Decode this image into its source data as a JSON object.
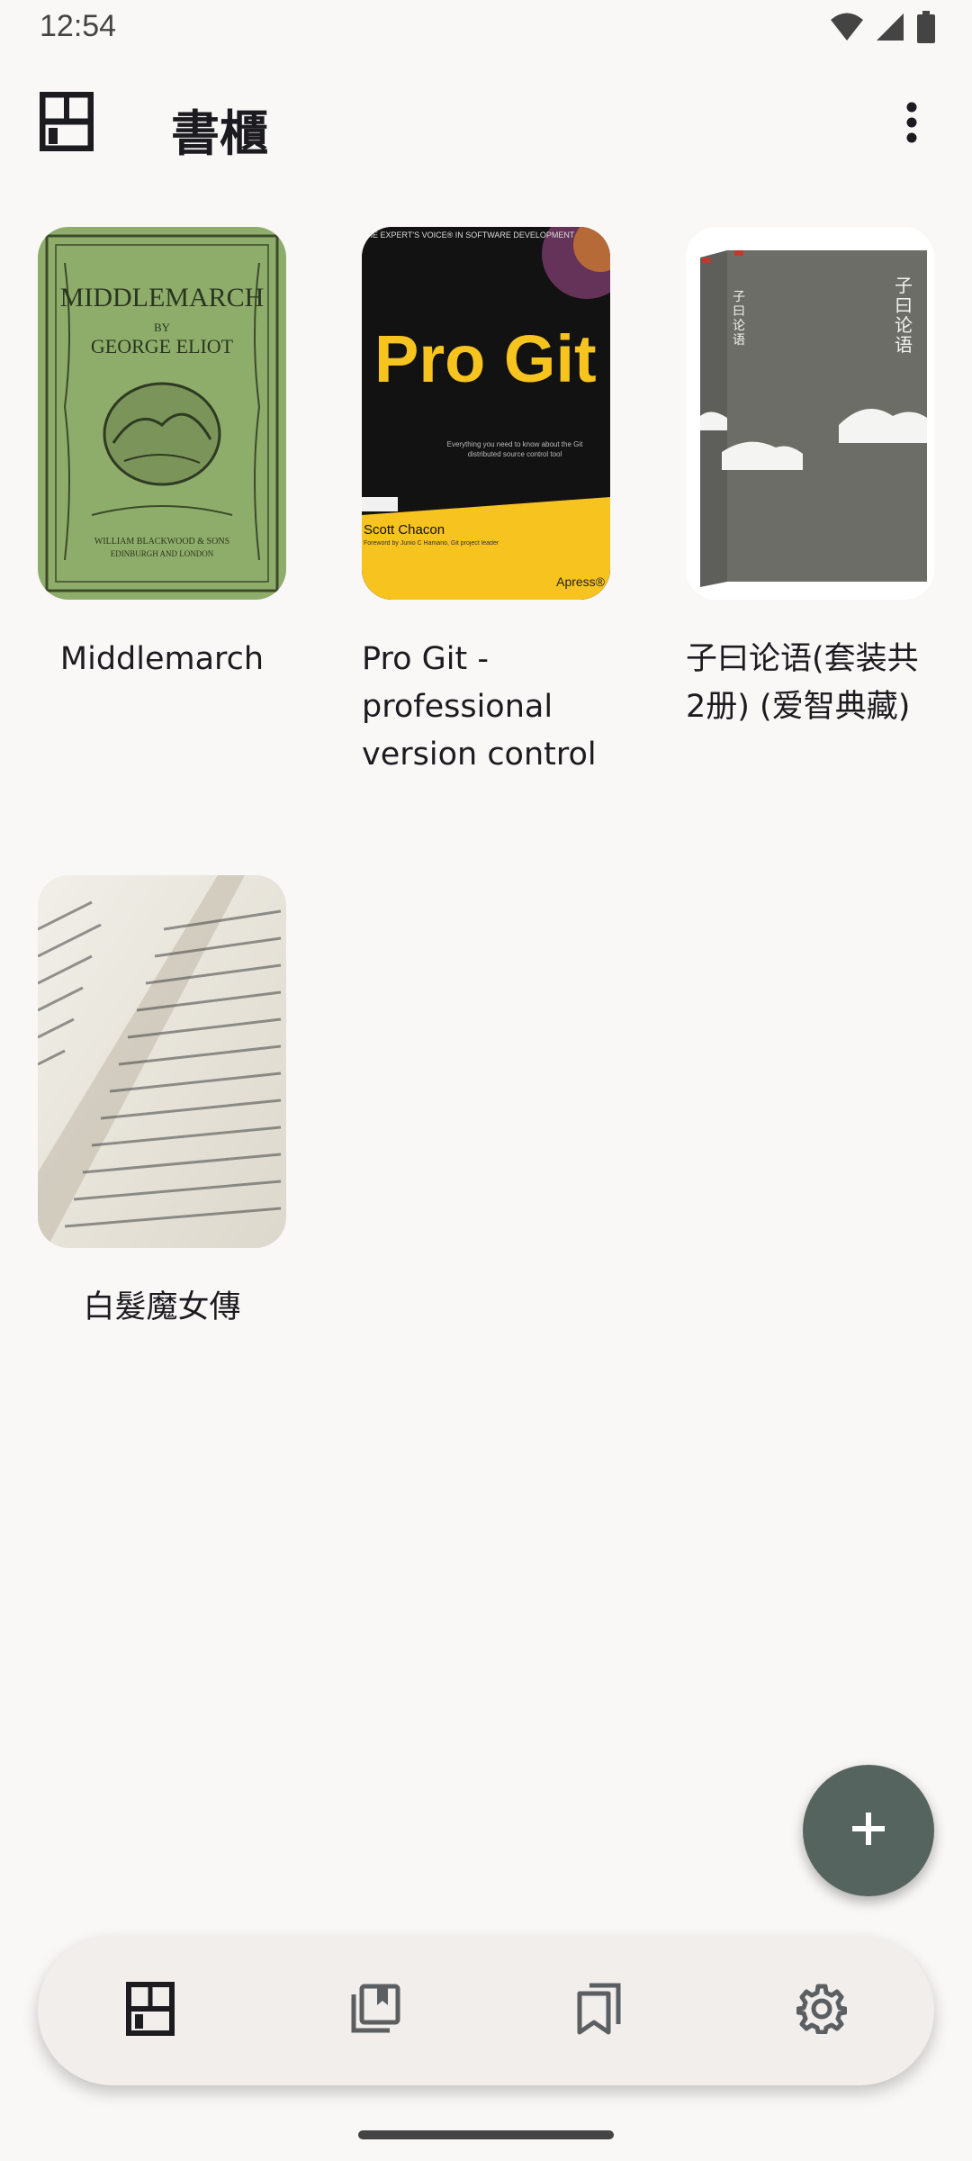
{
  "status_bar": {
    "time": "12:54",
    "icons": [
      "wifi-icon",
      "signal-icon",
      "battery-icon"
    ]
  },
  "app_bar": {
    "title": "書櫃",
    "logo_icon": "bookshelf-icon",
    "menu_icon": "more-vert-icon"
  },
  "books": [
    {
      "title": "Middlemarch",
      "cover": {
        "type": "illustration",
        "color": "#8fad6a",
        "text_lines": [
          "MIDDLEMARCH",
          "BY",
          "GEORGE ELIOT",
          "WILLIAM BLACKWOOD & SONS",
          "EDINBURGH AND LONDON"
        ]
      }
    },
    {
      "title": "Pro Git - professional version control",
      "cover": {
        "type": "illustration",
        "color": "#111111",
        "accent": "#f7c31f",
        "text_lines": [
          "THE EXPERT'S VOICE® IN SOFTWARE DEVELOPMENT",
          "Pro Git",
          "Everything you need to know about the Git distributed source control tool",
          "Scott Chacon",
          "Foreword by Junio C Hamano, Git project leader",
          "Apress®"
        ]
      }
    },
    {
      "title": "子曰论语(套装共2册) (爱智典藏)",
      "cover": {
        "type": "illustration",
        "color": "#6d6d68",
        "text_lines": [
          "子曰论语",
          "子曰论语"
        ]
      }
    },
    {
      "title": "白髮魔女傳",
      "cover": {
        "type": "photo",
        "description_icon": "open-book-photo"
      }
    }
  ],
  "fab": {
    "icon": "plus-icon"
  },
  "bottom_nav": {
    "items": [
      {
        "icon": "bookshelf-icon",
        "selected": true
      },
      {
        "icon": "library-books-icon",
        "selected": false
      },
      {
        "icon": "bookmarks-icon",
        "selected": false
      },
      {
        "icon": "settings-icon",
        "selected": false
      }
    ]
  },
  "colors": {
    "background": "#faf8f7",
    "nav_background": "#f1eeec",
    "fab": "#566460",
    "icon": "#5b5f61",
    "icon_selected": "#1c1b1f"
  }
}
